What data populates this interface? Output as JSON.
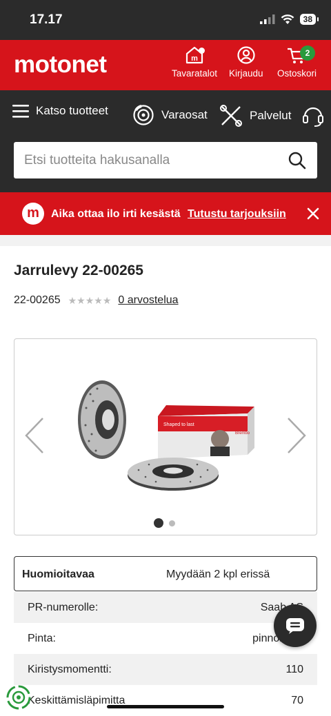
{
  "status_bar": {
    "time": "17.17",
    "battery": "38"
  },
  "header": {
    "logo": "motonet",
    "stores_label": "Tavaratalot",
    "login_label": "Kirjaudu",
    "cart_label": "Ostoskori",
    "cart_count": "2"
  },
  "nav": {
    "products_label": "Katso tuotteet",
    "parts_label": "Varaosat",
    "services_label": "Palvelut"
  },
  "search": {
    "placeholder": "Etsi tuotteita hakusanalla"
  },
  "promo": {
    "logo_letter": "m",
    "text": "Aika ottaa ilo irti kesästä",
    "link": "Tutustu tarjouksiin"
  },
  "product": {
    "title": "Jarrulevy 22-00265",
    "code": "22-00265",
    "stars": "★★★★★",
    "reviews": "0 arvostelua"
  },
  "gallery": {
    "box_text_1": "Shaped to last",
    "box_text_2": "Brembo"
  },
  "notice": {
    "label": "Huomioitavaa",
    "value": "Myydään 2 kpl erissä"
  },
  "specs": [
    {
      "key": "PR-numerolle:",
      "value": "Saab AS"
    },
    {
      "key": "Pinta:",
      "value": "pinnoitettu"
    },
    {
      "key": "Kiristysmomentti:",
      "value": "110"
    },
    {
      "key": "Keskittämisläpimitta",
      "value": "70"
    }
  ],
  "colors": {
    "brand_red": "#d6141b",
    "dark": "#2b2b2b",
    "badge_green": "#2a9a3c"
  }
}
